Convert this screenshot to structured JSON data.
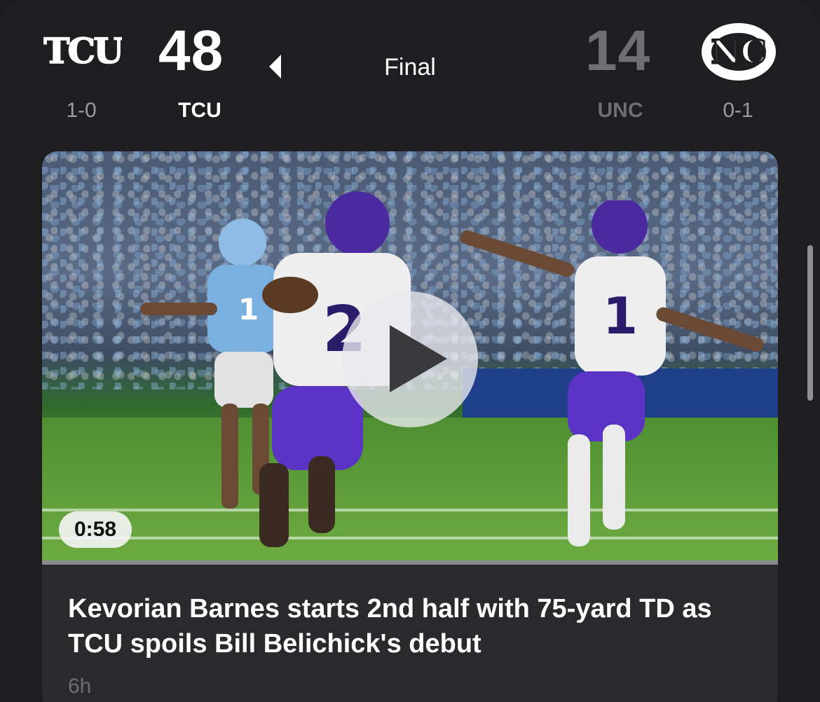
{
  "game": {
    "status": "Final",
    "home": {
      "abbr": "TCU",
      "score": "48",
      "record": "1-0",
      "logo_text": "TCU",
      "winner": true
    },
    "away": {
      "abbr": "UNC",
      "score": "14",
      "record": "0-1",
      "logo_text": "NC",
      "winner": false
    }
  },
  "highlight": {
    "duration": "0:58",
    "headline": "Kevorian Barnes starts 2nd half with 75-yard TD as TCU spoils Bill Belichick's debut",
    "timestamp": "6h"
  },
  "colors": {
    "background": "#1e1e20",
    "card": "#2a2a2d",
    "winner_text": "#ffffff",
    "loser_text": "#6e6e73",
    "muted_text": "#9a9aa0"
  },
  "icons": {
    "winner_indicator": "caret-left-icon",
    "play": "play-icon"
  }
}
